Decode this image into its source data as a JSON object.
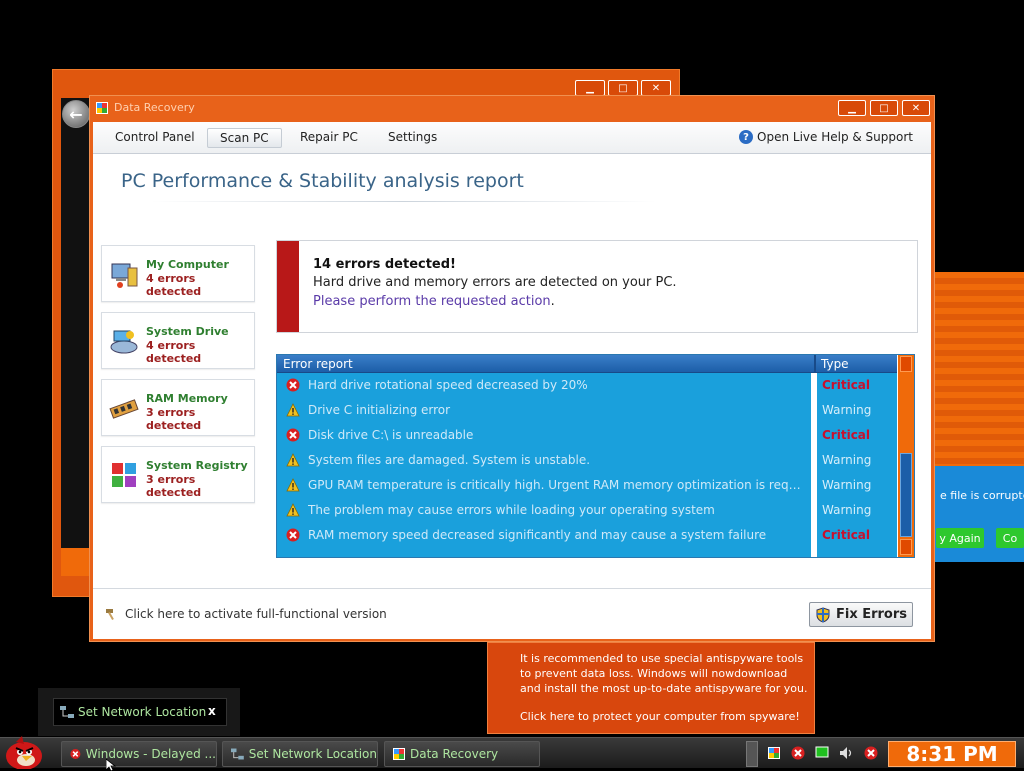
{
  "background_window": {
    "buttons": [
      "▁",
      "□",
      "✕"
    ]
  },
  "right_window": {
    "text": "e file is corrupted o",
    "button1_label": "y Again",
    "button2_label": "Co"
  },
  "window": {
    "title": "Data Recovery",
    "minimize_label": "▁",
    "maximize_label": "□",
    "close_label": "✕"
  },
  "menu": {
    "items": [
      {
        "label": "Control Panel"
      },
      {
        "label": "Scan PC"
      },
      {
        "label": "Repair PC"
      },
      {
        "label": "Settings"
      }
    ],
    "active": "Scan PC",
    "help_label": "Open Live Help & Support"
  },
  "report_title": "PC Performance & Stability analysis report",
  "sidebar": {
    "items": [
      {
        "name": "My Computer",
        "errors": "4 errors detected",
        "icon": "computer-icon"
      },
      {
        "name": "System Drive",
        "errors": "4 errors detected",
        "icon": "drive-icon"
      },
      {
        "name": "RAM Memory",
        "errors": "3 errors detected",
        "icon": "ram-icon"
      },
      {
        "name": "System Registry",
        "errors": "3 errors detected",
        "icon": "registry-icon"
      }
    ]
  },
  "alert": {
    "title": "14 errors detected!",
    "text": "Hard drive and memory errors are detected on your PC.",
    "link_prefix": "Please perform the requested action",
    "link_suffix": "."
  },
  "error_report": {
    "headers": {
      "report": "Error report",
      "type": "Type"
    },
    "rows": [
      {
        "text": "Hard drive rotational speed decreased by 20%",
        "type": "Critical",
        "icon": "error-icon"
      },
      {
        "text": "Drive C initializing error",
        "type": "Warning",
        "icon": "warning-icon"
      },
      {
        "text": "Disk drive C:\\ is unreadable",
        "type": "Critical",
        "icon": "error-icon"
      },
      {
        "text": "System files are damaged. System is unstable.",
        "type": "Warning",
        "icon": "warning-icon"
      },
      {
        "text": "GPU RAM temperature is critically high. Urgent RAM memory optimization is required ...",
        "type": "Warning",
        "icon": "warning-icon"
      },
      {
        "text": "The problem may cause errors while loading your operating system",
        "type": "Warning",
        "icon": "warning-icon"
      },
      {
        "text": "RAM memory speed decreased significantly and may cause a system failure",
        "type": "Critical",
        "icon": "error-icon"
      }
    ]
  },
  "footer": {
    "activate_label": "Click here to activate full-functional version",
    "fix_label": "Fix Errors"
  },
  "popup": {
    "text": "It is recommended to use special antispyware tools to prevent data loss. Windows will nowdownload and install the most up-to-date antispyware for you.",
    "link": "Click here to protect your computer from spyware!"
  },
  "network_popup": {
    "label": "Set Network Location",
    "close_label": "x"
  },
  "taskbar": {
    "tasks": [
      {
        "label": "Windows - Delayed ..."
      },
      {
        "label": "Set Network Location"
      },
      {
        "label": "Data Recovery"
      }
    ],
    "clock": "8:31 PM"
  },
  "colors": {
    "accent_orange": "#e8621a",
    "critical_red": "#c8102e",
    "table_blue": "#1aa0dc"
  }
}
